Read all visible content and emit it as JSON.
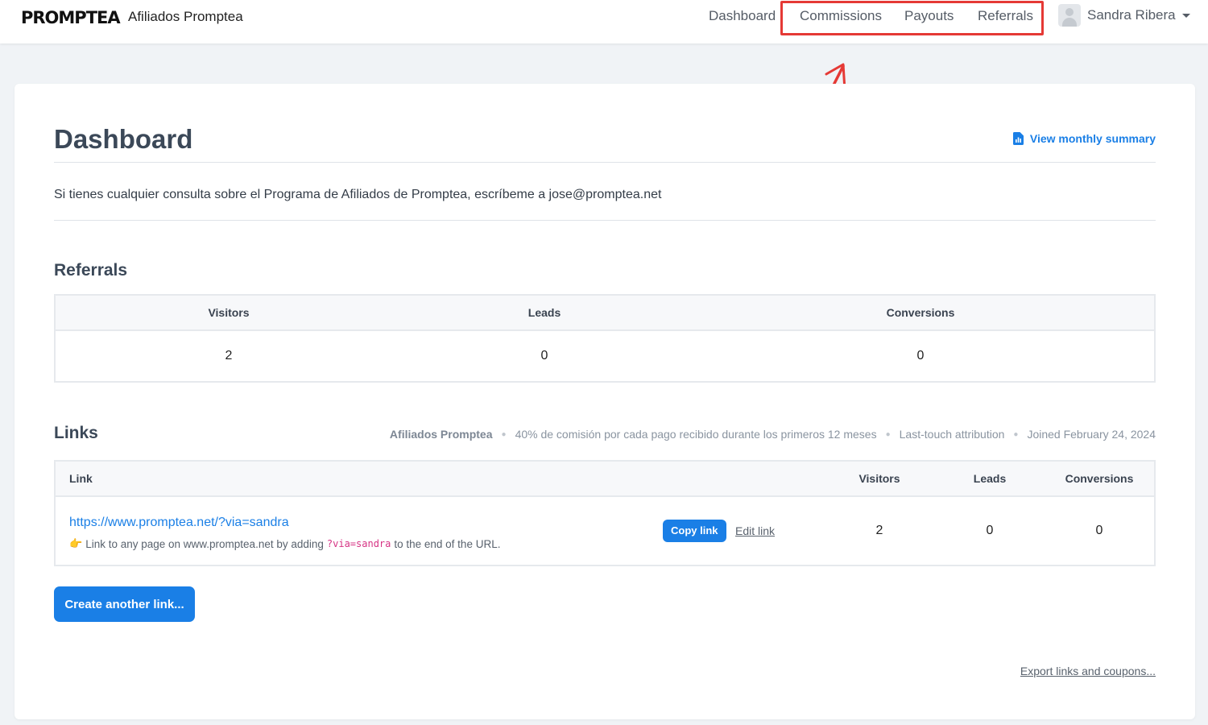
{
  "header": {
    "logo_text": "PROMPTEA",
    "brand_name": "Afiliados Promptea",
    "nav": {
      "dashboard": "Dashboard",
      "commissions": "Commissions",
      "payouts": "Payouts",
      "referrals": "Referrals"
    },
    "user_name": "Sandra Ribera",
    "highlight_color": "#e53935"
  },
  "page": {
    "title": "Dashboard",
    "summary_link": "View monthly summary",
    "intro": "Si tienes cualquier consulta sobre el Programa de Afiliados de Promptea, escríbeme a jose@promptea.net"
  },
  "referrals": {
    "title": "Referrals",
    "headers": {
      "visitors": "Visitors",
      "leads": "Leads",
      "conversions": "Conversions"
    },
    "values": {
      "visitors": "2",
      "leads": "0",
      "conversions": "0"
    }
  },
  "links": {
    "title": "Links",
    "meta": {
      "program": "Afiliados Promptea",
      "commission": "40% de comisión por cada pago recibido durante los primeros 12 meses",
      "attribution": "Last-touch attribution",
      "joined": "Joined February 24, 2024"
    },
    "headers": {
      "link": "Link",
      "visitors": "Visitors",
      "leads": "Leads",
      "conversions": "Conversions"
    },
    "rows": [
      {
        "url": "https://www.promptea.net/?via=sandra",
        "hint_prefix": "Link to any page on www.promptea.net by adding",
        "hint_code": "?via=sandra",
        "hint_suffix": "to the end of the URL.",
        "copy_label": "Copy link",
        "edit_label": "Edit link",
        "visitors": "2",
        "leads": "0",
        "conversions": "0"
      }
    ],
    "create_label": "Create another link...",
    "export_label": "Export links and coupons..."
  },
  "colors": {
    "accent": "#1a7fe6",
    "background": "#f0f3f6"
  }
}
